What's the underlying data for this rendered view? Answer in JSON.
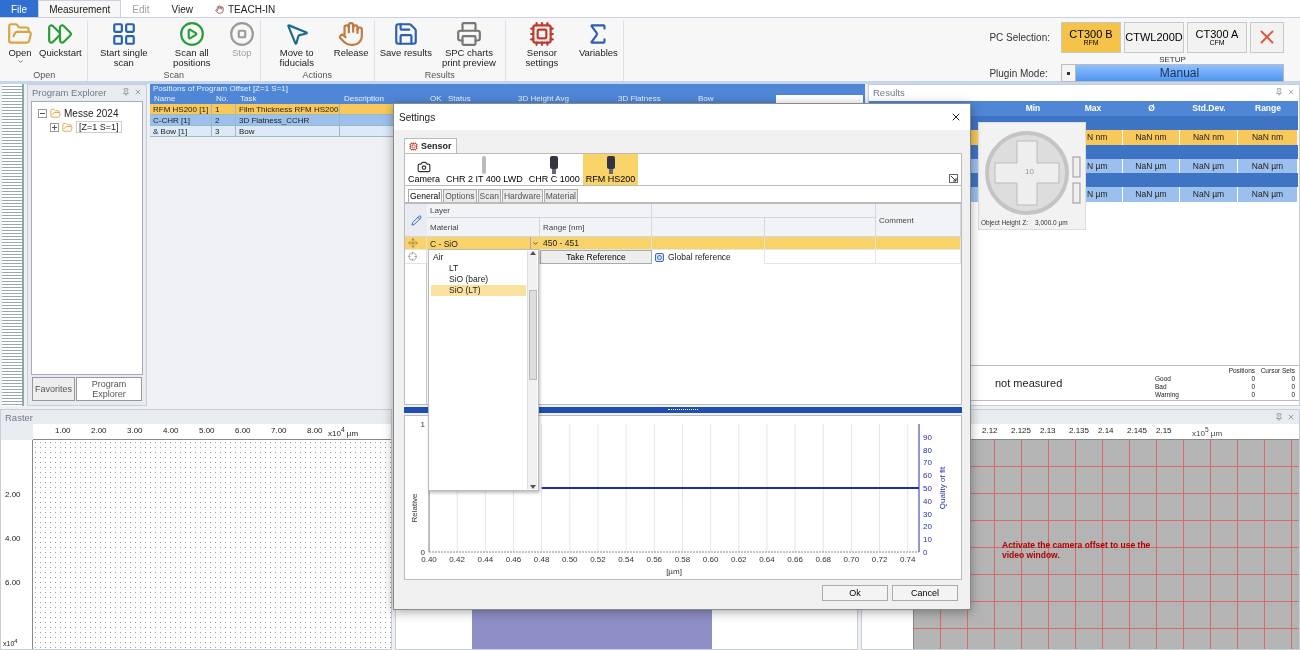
{
  "ribbon": {
    "tabs": [
      {
        "label": "File",
        "kind": "file",
        "selected": false,
        "disabled": false
      },
      {
        "label": "Measurement",
        "kind": "plain",
        "selected": true,
        "disabled": false
      },
      {
        "label": "Edit",
        "kind": "plain",
        "selected": false,
        "disabled": true
      },
      {
        "label": "View",
        "kind": "plain",
        "selected": false,
        "disabled": false
      },
      {
        "label": "TEACH-IN",
        "kind": "teach",
        "selected": false,
        "disabled": false
      }
    ],
    "groups": [
      {
        "label": "Open",
        "buttons": [
          {
            "label": "Open",
            "kind": "open",
            "disabled": false,
            "dropdown": true
          },
          {
            "label": "Quickstart",
            "kind": "quickstart",
            "disabled": false,
            "dropdown": false
          }
        ]
      },
      {
        "label": "Scan",
        "buttons": [
          {
            "label": "Start single scan",
            "kind": "single",
            "disabled": false,
            "dropdown": false
          },
          {
            "label": "Scan all positions",
            "kind": "all",
            "disabled": false,
            "dropdown": false
          },
          {
            "label": "Stop",
            "kind": "stop",
            "disabled": true,
            "dropdown": false
          }
        ]
      },
      {
        "label": "Actions",
        "buttons": [
          {
            "label": "Move to fiducials",
            "kind": "move",
            "disabled": false,
            "dropdown": false
          },
          {
            "label": "Release",
            "kind": "release",
            "disabled": false,
            "dropdown": false
          }
        ]
      },
      {
        "label": "Results",
        "buttons": [
          {
            "label": "Save results",
            "kind": "save",
            "disabled": false,
            "dropdown": false
          },
          {
            "label": "SPC charts print preview",
            "kind": "spc",
            "disabled": false,
            "dropdown": false
          }
        ]
      },
      {
        "buttons": [
          {
            "label": "Sensor settings",
            "kind": "sensor",
            "disabled": false,
            "dropdown": false
          },
          {
            "label": "Variables",
            "kind": "variables",
            "disabled": false,
            "dropdown": false
          }
        ]
      }
    ],
    "pc_selection": {
      "label": "PC Selection:",
      "options": [
        {
          "label": "CT300 B",
          "sub": "RFM",
          "selected": true
        },
        {
          "label": "CTWL200D",
          "selected": false
        },
        {
          "label": "CT300 A",
          "sub": "CFM",
          "selected": false
        }
      ],
      "setup": "SETUP"
    },
    "plugin_mode": {
      "label": "Plugin Mode:",
      "value": "Manual"
    }
  },
  "program_explorer": {
    "title": "Program Explorer",
    "tree": [
      {
        "label": "Messe 2024",
        "expanded": true,
        "children": [
          {
            "label": "[Z=1 S=1]",
            "expanded": false
          }
        ]
      }
    ],
    "tabs": [
      {
        "label": "Favorites",
        "selected": false
      },
      {
        "label": "Program Explorer",
        "selected": true
      }
    ]
  },
  "positions": {
    "title": "Positions of Program Offset [Z=1 S=1]",
    "columns": [
      "Name",
      "No.",
      "Task",
      "Description",
      "OK",
      "Status",
      "3D Height Avg",
      "3D Flatness",
      "Bow"
    ],
    "rows": [
      {
        "cells": [
          "RFM HS200 [1]",
          "1",
          "Film Thickness RFM HS200"
        ],
        "selected": true,
        "highlighted": false
      },
      {
        "cells": [
          "C-CHR [1]",
          "2",
          "3D Flatness_CCHR"
        ],
        "selected": false,
        "highlighted": true
      },
      {
        "cells": [
          "& Bow [1]",
          "3",
          "Bow"
        ],
        "selected": false,
        "highlighted": false
      }
    ]
  },
  "results": {
    "title": "Results",
    "columns": [
      "Min",
      "Max",
      "Ø",
      "Std.Dev.",
      "Range"
    ],
    "rows": [
      {
        "kind": "group"
      },
      {
        "kind": "data",
        "selected": true,
        "cells": [
          "N nm",
          "NaN nm",
          "NaN nm",
          "NaN nm"
        ]
      },
      {
        "kind": "group"
      },
      {
        "kind": "data",
        "selected": false,
        "cells": [
          "N µm",
          "NaN µm",
          "NaN µm",
          "NaN µm"
        ]
      },
      {
        "kind": "group"
      },
      {
        "kind": "data",
        "selected": false,
        "cells": [
          "N µm",
          "NaN µm",
          "NaN µm",
          "NaN µm"
        ]
      }
    ],
    "joystick": {
      "label": "10",
      "height_label": "Object Height Z:",
      "height_value": "3,000.0 µm"
    },
    "summary": {
      "status": "not measured",
      "columns": [
        "Positions",
        "Cursor Sets"
      ],
      "rows": [
        {
          "label": "Good",
          "values": [
            "0",
            "0"
          ]
        },
        {
          "label": "Bad",
          "values": [
            "0",
            "0"
          ]
        },
        {
          "label": "Warning",
          "values": [
            "0",
            "0"
          ]
        }
      ]
    }
  },
  "raster": {
    "title": "Raster",
    "xticks": [
      "1.00",
      "2.00",
      "3.00",
      "4.00",
      "5.00",
      "6.00",
      "7.00",
      "8.00"
    ],
    "xunit": "x10$^{4}$ µm",
    "yticks": [
      "2.00",
      "4.00",
      "6.00"
    ],
    "yunit": "x10$^{4}$"
  },
  "camera": {
    "xticks": [
      "2.12",
      "2.125",
      "2.13",
      "2.135",
      "2.14",
      "2.145",
      "2.15"
    ],
    "xunit": "x10$^{5}$ µm",
    "message": "Activate the camera offset to use the video window."
  },
  "dialog": {
    "title": "Settings",
    "sensor_tab": "Sensor",
    "sensors": [
      {
        "label": "Camera",
        "kind": "camera",
        "selected": false
      },
      {
        "label": "CHR 2 IT 400 LWD",
        "kind": "pen",
        "selected": false
      },
      {
        "label": "CHR C 1000",
        "kind": "probe",
        "selected": false
      },
      {
        "label": "RFM HS200",
        "kind": "probe",
        "selected": true
      }
    ],
    "tabs": [
      {
        "label": "General",
        "selected": true
      },
      {
        "label": "Options",
        "selected": false
      },
      {
        "label": "Scan",
        "selected": false
      },
      {
        "label": "Hardware",
        "selected": false
      },
      {
        "label": "Material",
        "selected": false
      }
    ],
    "grid": {
      "group": "Layer",
      "material": "Material",
      "range": "Range [nm]",
      "comment": "Comment",
      "row": {
        "material": "C - SiO",
        "range": "450 - 451"
      },
      "reference_button": "Take Reference",
      "global_reference": "Global reference"
    },
    "dropdown": [
      {
        "label": "Air",
        "selected": false,
        "children": [
          {
            "label": "LT",
            "selected": false
          },
          {
            "label": "SiO (bare)",
            "selected": false
          },
          {
            "label": "SiO (LT)",
            "selected": true
          }
        ]
      }
    ],
    "relative_axis": {
      "label": "Relative",
      "ticks": [
        "1",
        "0"
      ]
    },
    "chart_data": {
      "type": "line",
      "xlabel": "[µm]",
      "x": [
        0.48,
        0.748
      ],
      "series": [
        {
          "name": "Quality of fit",
          "color": "#1a2fb0",
          "values": [
            50,
            50
          ]
        }
      ],
      "grid": true,
      "xlim": [
        0.4,
        0.748
      ],
      "ylim": [
        0,
        100
      ],
      "xticks": [
        {
          "value": 0.4,
          "label": "0.40"
        },
        {
          "value": 0.42,
          "label": "0.42"
        },
        {
          "value": 0.44,
          "label": "0.44"
        },
        {
          "value": 0.46,
          "label": "0.46"
        },
        {
          "value": 0.48,
          "label": "0.48"
        },
        {
          "value": 0.5,
          "label": "0.50"
        },
        {
          "value": 0.52,
          "label": "0.52"
        },
        {
          "value": 0.54,
          "label": "0.54"
        },
        {
          "value": 0.56,
          "label": "0.56"
        },
        {
          "value": 0.58,
          "label": "0.58"
        },
        {
          "value": 0.6,
          "label": "0.60"
        },
        {
          "value": 0.62,
          "label": "0.62"
        },
        {
          "value": 0.64,
          "label": "0.64"
        },
        {
          "value": 0.66,
          "label": "0.66"
        },
        {
          "value": 0.68,
          "label": "0.68"
        },
        {
          "value": 0.7,
          "label": "0.70"
        },
        {
          "value": 0.72,
          "label": "0.72"
        },
        {
          "value": 0.74,
          "label": "0.74"
        }
      ],
      "yticks": [
        0,
        10,
        20,
        30,
        40,
        50,
        60,
        70,
        80,
        90
      ]
    },
    "buttons": [
      "Ok",
      "Cancel"
    ]
  }
}
